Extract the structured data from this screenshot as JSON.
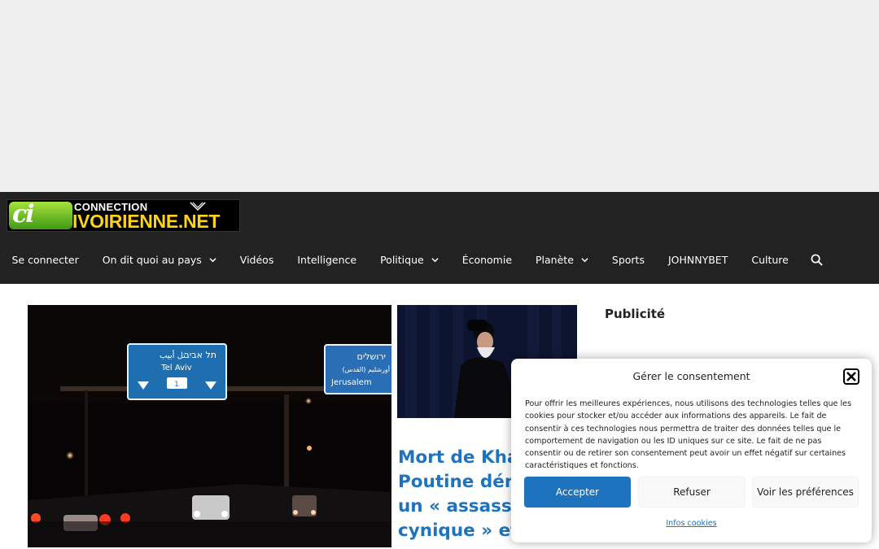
{
  "site": {
    "logo_line1": "CONNECTION",
    "logo_line2": "IVOIRIENNE.NET",
    "logo_mark": "ci"
  },
  "nav": {
    "items": [
      {
        "label": "Se connecter",
        "dropdown": false
      },
      {
        "label": "On dit quoi au pays",
        "dropdown": true
      },
      {
        "label": "Vidéos",
        "dropdown": false
      },
      {
        "label": "Intelligence",
        "dropdown": false
      },
      {
        "label": "Politique",
        "dropdown": true
      },
      {
        "label": "Économie",
        "dropdown": false
      },
      {
        "label": "Planète",
        "dropdown": true
      },
      {
        "label": "Sports",
        "dropdown": false
      },
      {
        "label": "JOHNNYBET",
        "dropdown": false
      },
      {
        "label": "Culture",
        "dropdown": false
      }
    ],
    "search_icon": "search-icon"
  },
  "images": {
    "main_sign_hebrew": "תל אביב",
    "main_sign_arabic": "تل أبيب",
    "main_sign_en": "Tel Aviv",
    "main_sign_num": "1",
    "main_sign2_hebrew": "ירושלים",
    "main_sign2_arabic": "أورشليم (القدس)",
    "main_sign2_en": "Jerusalem"
  },
  "featured": {
    "headline": "Mort de Kha\nPoutine dén\nun « assass\ncynique » et"
  },
  "sidebar": {
    "widget_title": "Publicité"
  },
  "consent": {
    "title": "Gérer le consentement",
    "body": "Pour offrir les meilleures expériences, nous utilisons des technologies telles que les cookies pour stocker et/ou accéder aux informations des appareils. Le fait de consentir à ces technologies nous permettra de traiter des données telles que le comportement de navigation ou les ID uniques sur ce site. Le fait de ne pas consentir ou de retirer son consentement peut avoir un effet négatif sur certaines caractéristiques et fonctions.",
    "accept_label": "Accepter",
    "refuse_label": "Refuser",
    "prefs_label": "Voir les préférences",
    "link_label": "Infos cookies"
  },
  "colors": {
    "header_bg": "#222222",
    "accent_blue": "#1e73be",
    "banner_bg": "#efefef",
    "logo_yellow": "#ffd21a",
    "logo_green": "#5cb82a"
  }
}
